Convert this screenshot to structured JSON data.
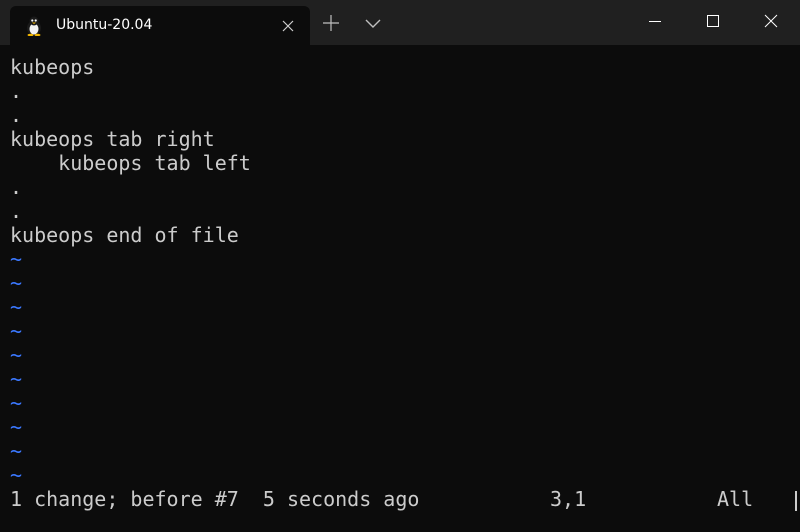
{
  "tab": {
    "title": "Ubuntu-20.04",
    "icon": "tux-penguin-icon"
  },
  "titlebar": {
    "new_tab_icon": "plus-icon",
    "dropdown_icon": "chevron-down-icon",
    "minimize_icon": "minimize-icon",
    "maximize_icon": "maximize-icon",
    "close_icon": "close-icon"
  },
  "editor": {
    "lines": [
      "kubeops",
      ".",
      ".",
      "kubeops tab right",
      "    kubeops tab left",
      ".",
      ".",
      "kubeops end of file"
    ],
    "empty_line_marker": "~",
    "empty_line_count": 10,
    "tilde_color": "#3b78ff"
  },
  "status": {
    "message": "1 change; before #7  5 seconds ago",
    "position": "3,1",
    "scroll": "All"
  },
  "colors": {
    "background": "#0c0c0c",
    "titlebar": "#202020",
    "text": "#cccccc"
  }
}
